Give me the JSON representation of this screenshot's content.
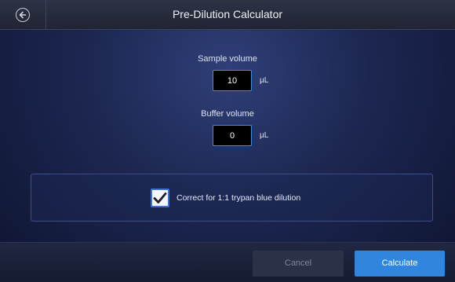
{
  "header": {
    "title": "Pre-Dilution Calculator"
  },
  "sample": {
    "label": "Sample volume",
    "value": "10",
    "unit": "µL"
  },
  "buffer": {
    "label": "Buffer volume",
    "value": "0",
    "unit": "µL"
  },
  "option": {
    "label": "Correct for 1:1 trypan blue dilution",
    "checked": true
  },
  "footer": {
    "cancel_label": "Cancel",
    "calculate_label": "Calculate"
  },
  "icons": {
    "back": "arrow-left-circle-icon",
    "check": "checkmark-icon"
  },
  "colors": {
    "accent": "#2f86dc",
    "input_border": "#3f8ee8"
  }
}
